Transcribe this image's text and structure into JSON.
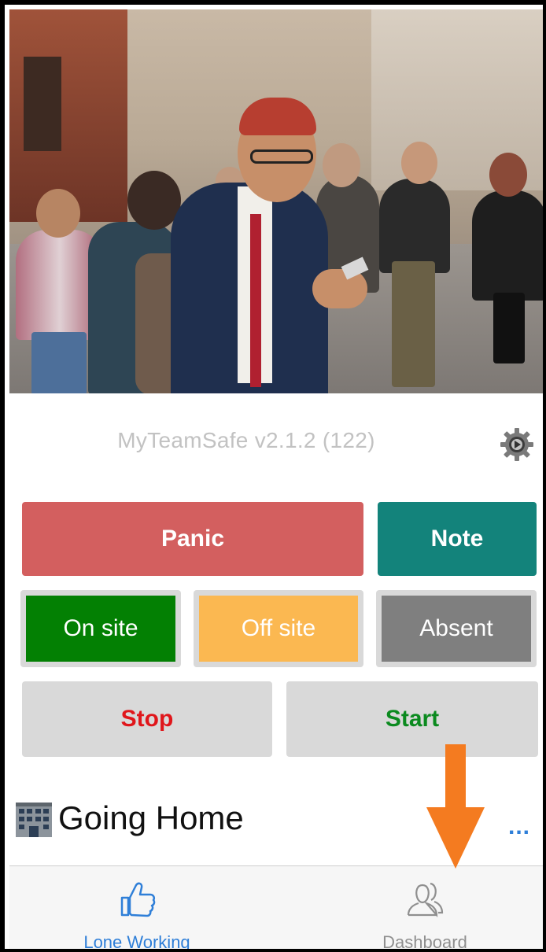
{
  "app": {
    "version_text": "MyTeamSafe v2.1.2 (122)"
  },
  "icons": {
    "settings": "gear-icon",
    "building": "office-building-icon",
    "more": "ellipsis-icon",
    "lone_working": "thumbs-up-icon",
    "dashboard": "people-icon",
    "annotation": "down-arrow-icon"
  },
  "actions": {
    "panic_label": "Panic",
    "note_label": "Note"
  },
  "status": {
    "on_site_label": "On site",
    "off_site_label": "Off site",
    "absent_label": "Absent"
  },
  "session": {
    "stop_label": "Stop",
    "start_label": "Start"
  },
  "current": {
    "title": "Going Home",
    "more_label": "..."
  },
  "tabs": [
    {
      "label": "Lone Working",
      "active": true
    },
    {
      "label": "Dashboard",
      "active": false
    }
  ],
  "colors": {
    "panic": "#d35f5f",
    "note": "#13837b",
    "on_site": "#038003",
    "off_site": "#fbb851",
    "absent": "#7f7f7f",
    "stop_text": "#e0161b",
    "start_text": "#0b8a1f",
    "tab_active": "#2f7fd8",
    "annotation_arrow": "#f47b20"
  }
}
